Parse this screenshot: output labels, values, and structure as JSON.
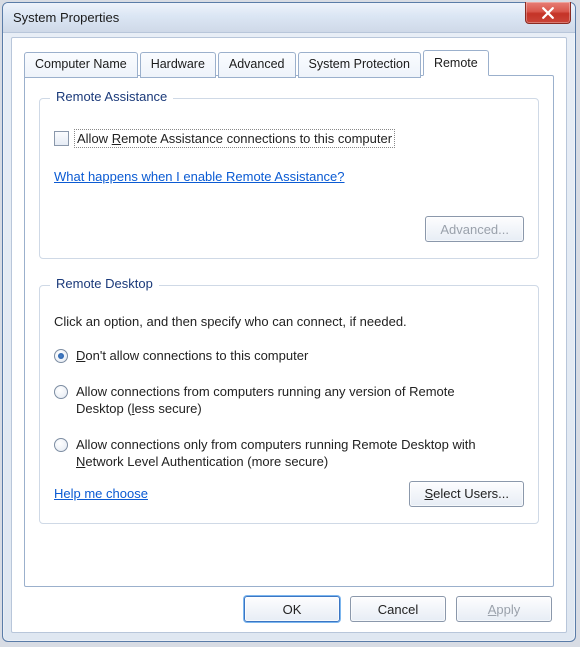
{
  "window": {
    "title": "System Properties"
  },
  "tabs": [
    "Computer Name",
    "Hardware",
    "Advanced",
    "System Protection",
    "Remote"
  ],
  "active_tab_index": 4,
  "remote_assistance": {
    "group_title": "Remote Assistance",
    "checkbox_label_pre": "Allow ",
    "checkbox_label_ukey": "R",
    "checkbox_label_post": "emote Assistance connections to this computer",
    "checked": false,
    "help_link": "What happens when I enable Remote Assistance?",
    "advanced_button": "Advanced..."
  },
  "remote_desktop": {
    "group_title": "Remote Desktop",
    "instruction": "Click an option, and then specify who can connect, if needed.",
    "options": [
      {
        "pre": "",
        "ukey": "D",
        "post": "on't allow connections to this computer"
      },
      {
        "pre": "Allow connections from computers running any version of Remote Desktop (",
        "ukey": "l",
        "post": "ess secure)"
      },
      {
        "pre": "Allow connections only from computers running Remote Desktop with ",
        "ukey": "N",
        "post": "etwork Level Authentication (more secure)"
      }
    ],
    "selected_index": 0,
    "help_link": "Help me choose",
    "select_users_button_pre": "",
    "select_users_button_ukey": "S",
    "select_users_button_post": "elect Users..."
  },
  "buttons": {
    "ok": "OK",
    "cancel": "Cancel",
    "apply_ukey": "A",
    "apply_post": "pply"
  }
}
